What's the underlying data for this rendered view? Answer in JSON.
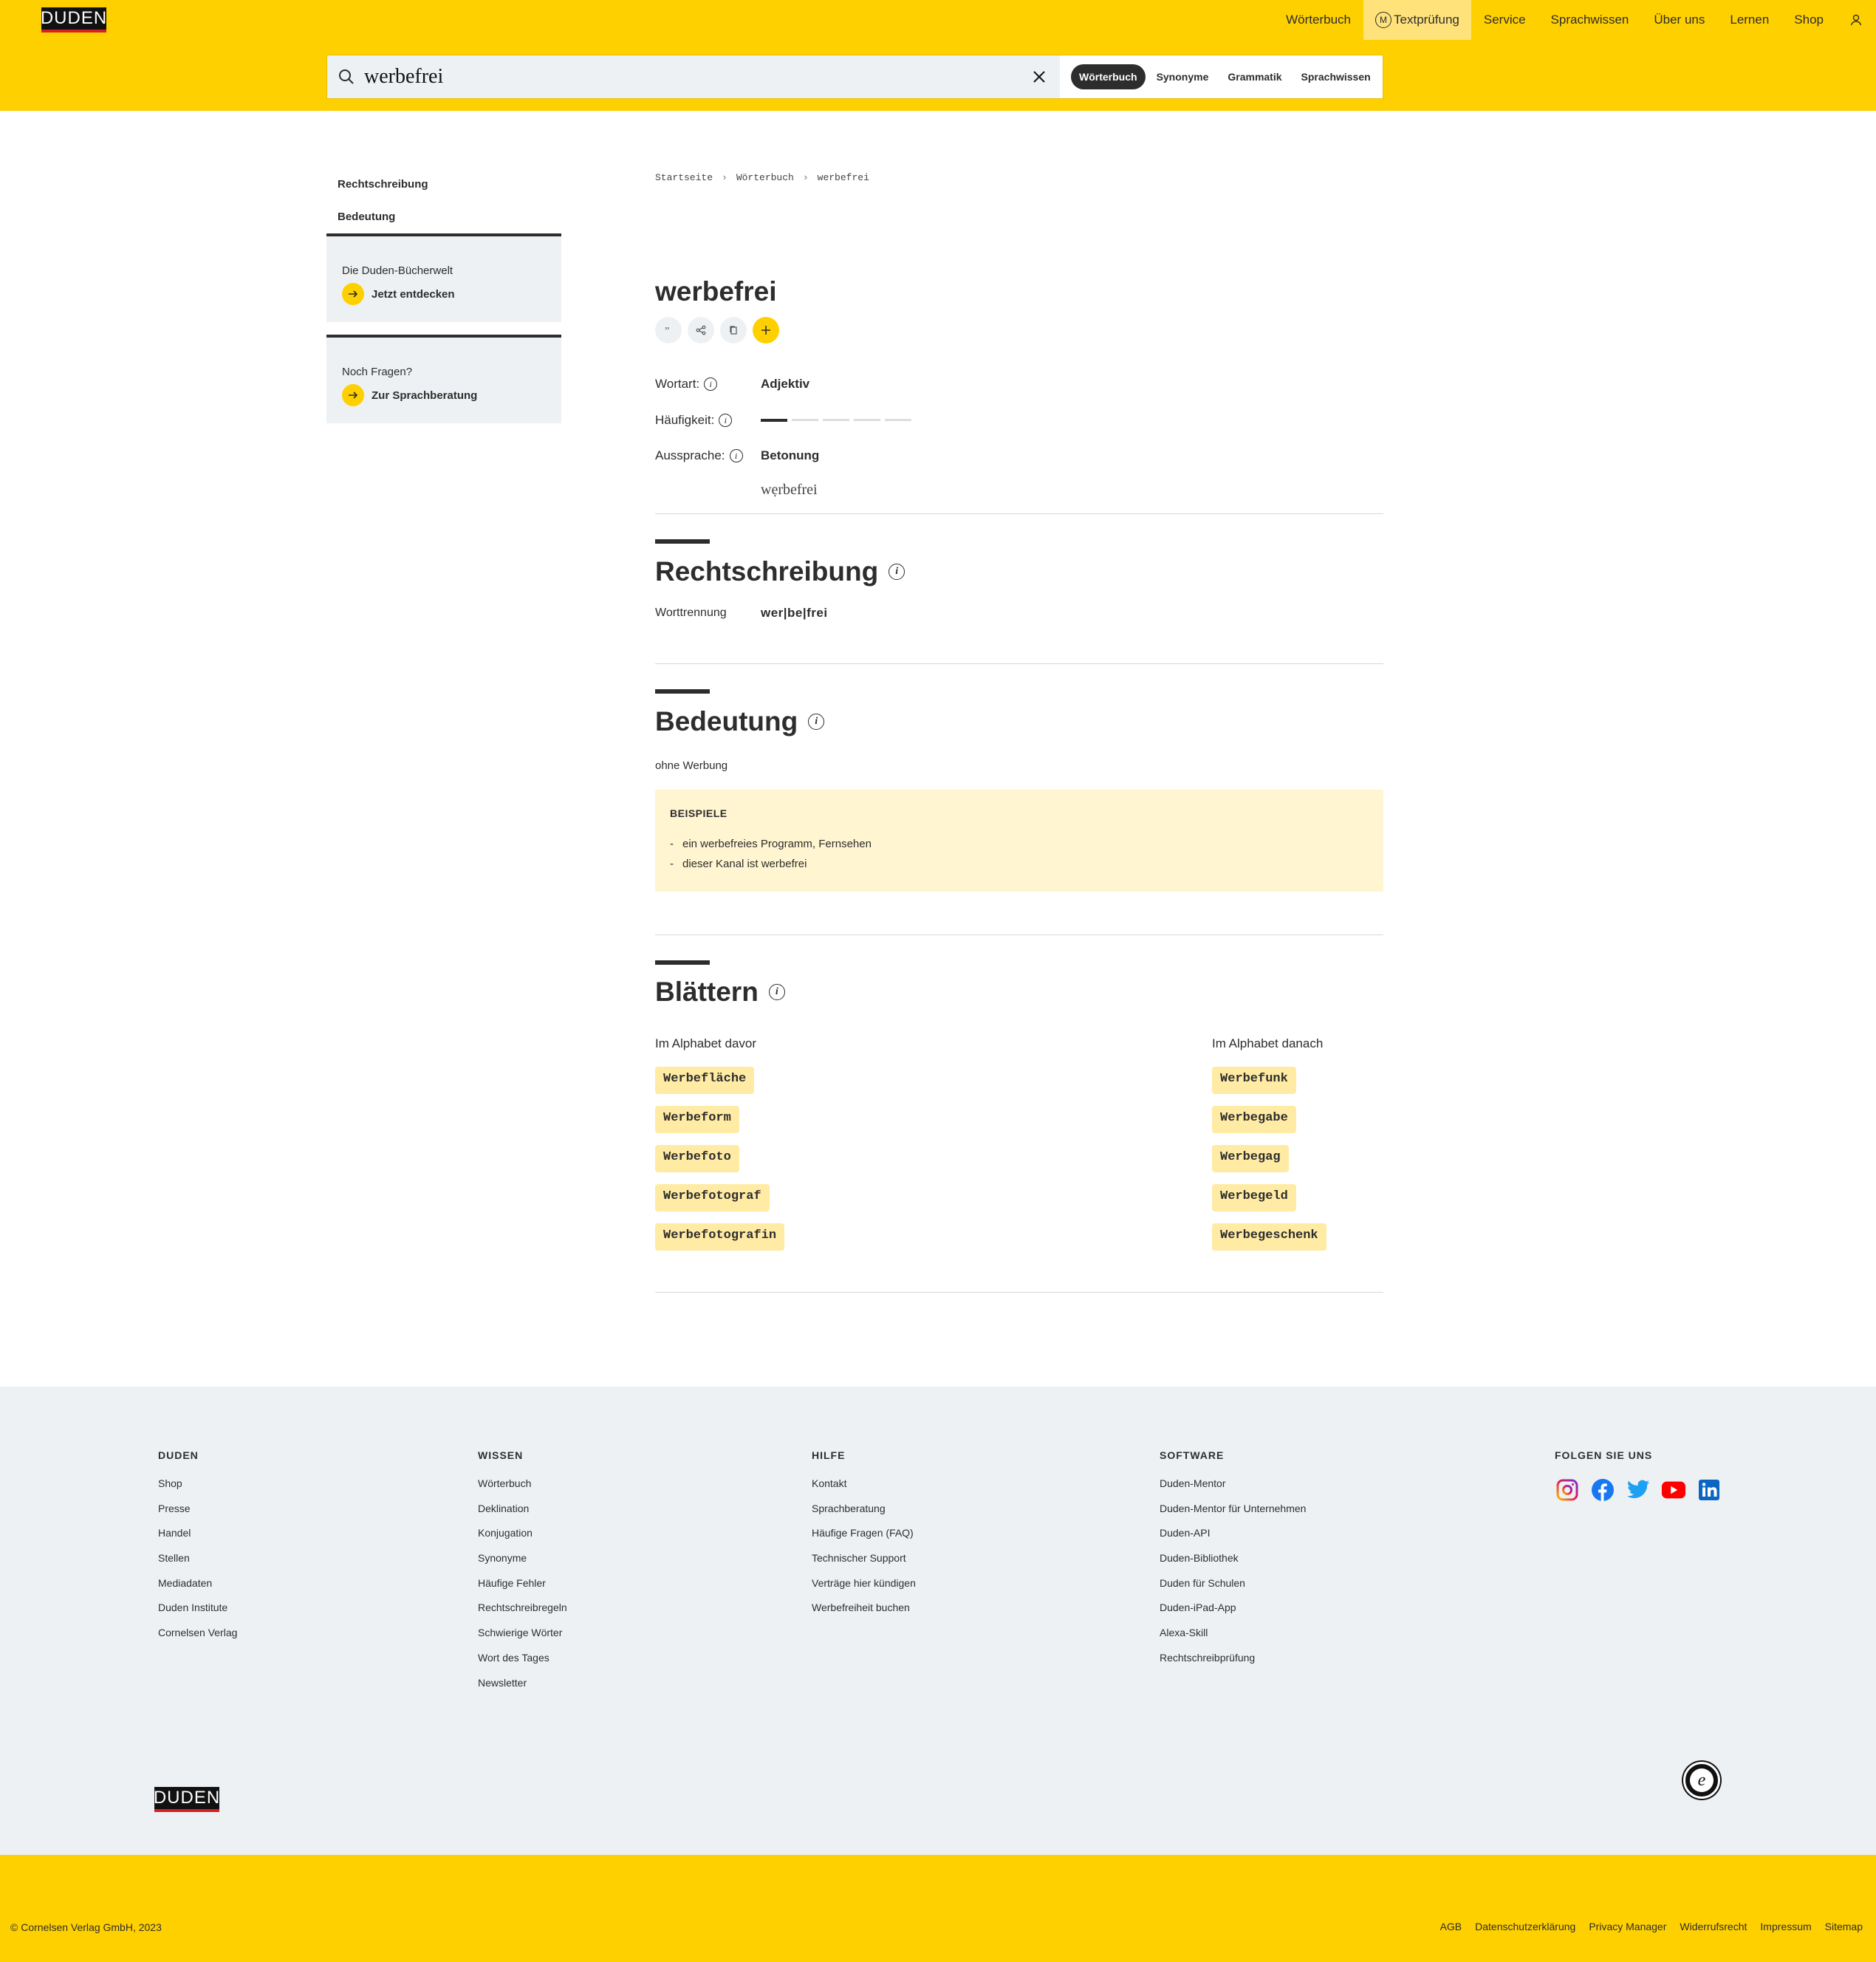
{
  "header": {
    "logo": "DUDEN",
    "nav": [
      "Wörterbuch",
      "Textprüfung",
      "Service",
      "Sprachwissen",
      "Über uns",
      "Lernen",
      "Shop"
    ],
    "mentor_badge": "M"
  },
  "search": {
    "value": "werbefrei",
    "pills": [
      "Wörterbuch",
      "Synonyme",
      "Grammatik",
      "Sprachwissen"
    ]
  },
  "sidebar": {
    "links": [
      "Rechtschreibung",
      "Bedeutung"
    ],
    "box1": {
      "question": "Die Duden-Bücherwelt",
      "cta": "Jetzt entdecken"
    },
    "box2": {
      "question": "Noch Fragen?",
      "cta": "Zur Sprachberatung"
    }
  },
  "breadcrumb": [
    "Startseite",
    "Wörterbuch",
    "werbefrei"
  ],
  "entry": {
    "lemma": "werbefrei",
    "wortart_label": "Wortart:",
    "wortart": "Adjektiv",
    "haeufigkeit_label": "Häufigkeit:",
    "haeufigkeit": 1,
    "haeufigkeit_max": 5,
    "aussprache_label": "Aussprache:",
    "betonung_label": "Betonung",
    "betonung": "wẹrbefrei"
  },
  "rechtschreibung": {
    "title": "Rechtschreibung",
    "worttrennung_label": "Worttrennung",
    "worttrennung": "wer|be|frei"
  },
  "bedeutung": {
    "title": "Bedeutung",
    "text": "ohne Werbung",
    "beispiele_label": "BEISPIELE",
    "beispiele": [
      "ein werbefreies Programm, Fernsehen",
      "dieser Kanal ist werbefrei"
    ]
  },
  "blaettern": {
    "title": "Blättern",
    "davor_label": "Im Alphabet davor",
    "danach_label": "Im Alphabet danach",
    "davor": [
      "Werbefläche",
      "Werbeform",
      "Werbefoto",
      "Werbefotograf",
      "Werbefotografin"
    ],
    "danach": [
      "Werbefunk",
      "Werbegabe",
      "Werbegag",
      "Werbegeld",
      "Werbegeschenk"
    ]
  },
  "footer": {
    "duden": {
      "title": "DUDEN",
      "links": [
        "Shop",
        "Presse",
        "Handel",
        "Stellen",
        "Mediadaten",
        "Duden Institute",
        "Cornelsen Verlag"
      ]
    },
    "wissen": {
      "title": "WISSEN",
      "links": [
        "Wörterbuch",
        "Deklination",
        "Konjugation",
        "Synonyme",
        "Häufige Fehler",
        "Rechtschreibregeln",
        "Schwierige Wörter",
        "Wort des Tages",
        "Newsletter"
      ]
    },
    "hilfe": {
      "title": "HILFE",
      "links": [
        "Kontakt",
        "Sprachberatung",
        "Häufige Fragen (FAQ)",
        "Technischer Support",
        "Verträge hier kündigen",
        "Werbefreiheit buchen"
      ]
    },
    "software": {
      "title": "SOFTWARE",
      "links": [
        "Duden-Mentor",
        "Duden-Mentor für Unternehmen",
        "Duden-API",
        "Duden-Bibliothek",
        "Duden für Schulen",
        "Duden-iPad-App",
        "Alexa-Skill",
        "Rechtschreibprüfung"
      ]
    },
    "folgen": {
      "title": "FOLGEN SIE UNS"
    },
    "logo": "DUDEN",
    "copyright": "© Cornelsen Verlag GmbH, 2023",
    "legal": [
      "AGB",
      "Datenschutzerklärung",
      "Privacy Manager",
      "Widerrufsrecht",
      "Impressum",
      "Sitemap"
    ]
  },
  "colors": {
    "brand_yellow": "#ffd000",
    "dark": "#2d2d2d",
    "example_bg": "#fff5d1",
    "chip_bg": "#ffeba4",
    "footer_bg": "#eef1f3"
  }
}
